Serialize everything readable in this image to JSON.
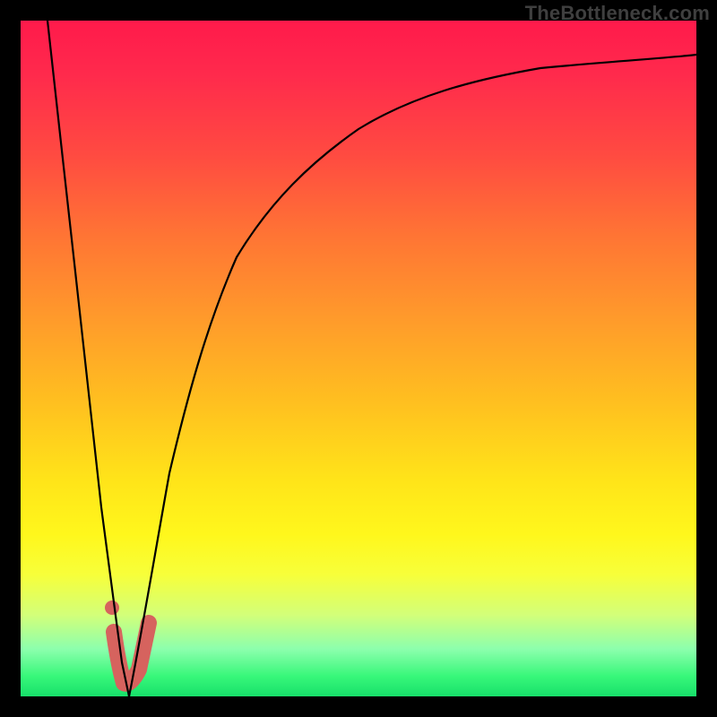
{
  "watermark": "TheBottleneck.com",
  "chart_data": {
    "type": "line",
    "title": "",
    "xlabel": "",
    "ylabel": "",
    "xlim": [
      0,
      100
    ],
    "ylim": [
      0,
      100
    ],
    "grid": false,
    "legend": false,
    "gradient_stops": [
      {
        "pos": 0,
        "color": "#ff1a4b"
      },
      {
        "pos": 20,
        "color": "#ff4b41"
      },
      {
        "pos": 44,
        "color": "#ff9a2b"
      },
      {
        "pos": 68,
        "color": "#ffe419"
      },
      {
        "pos": 82,
        "color": "#f7ff3a"
      },
      {
        "pos": 93,
        "color": "#8cffad"
      },
      {
        "pos": 100,
        "color": "#17e06a"
      }
    ],
    "series": [
      {
        "name": "left-branch",
        "x": [
          4,
          6,
          8,
          10,
          12,
          14,
          15,
          16
        ],
        "y": [
          100,
          82,
          64,
          46,
          28,
          12,
          5,
          0
        ]
      },
      {
        "name": "right-branch",
        "x": [
          16,
          18,
          20,
          22,
          25,
          28,
          32,
          37,
          43,
          50,
          58,
          67,
          77,
          88,
          100
        ],
        "y": [
          0,
          10,
          22,
          33,
          46,
          56,
          65,
          73,
          79,
          84,
          88,
          91,
          93,
          94.5,
          95
        ]
      }
    ],
    "highlight": {
      "name": "optimal-region",
      "color": "#d6635e",
      "path": {
        "x": [
          13.8,
          14.5,
          15.2,
          16.2,
          17.5,
          19.0
        ],
        "y": [
          9.5,
          4.8,
          2.0,
          1.5,
          4.0,
          10.8
        ]
      },
      "dot": {
        "x": 13.5,
        "y": 13.2
      }
    }
  }
}
